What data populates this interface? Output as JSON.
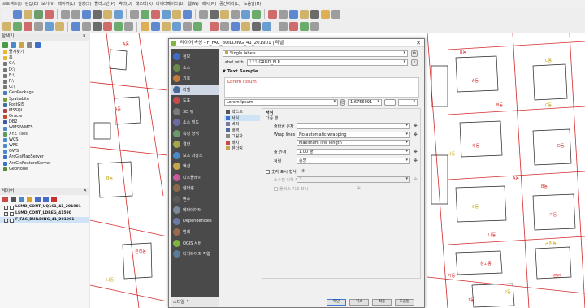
{
  "menubar": [
    "프로젝트(J)",
    "편집(E)",
    "보기(V)",
    "레이어(L)",
    "설정(S)",
    "플러그인(P)",
    "벡터(O)",
    "래스터(R)",
    "데이터베이스(D)",
    "웹(W)",
    "메시(M)",
    "공간처리(C)",
    "도움말(H)"
  ],
  "browser": {
    "title": "탐색기",
    "items": [
      {
        "label": "즐겨찾기",
        "icon": "star-icon",
        "color": "#e8b82c"
      },
      {
        "label": "홈",
        "icon": "folder-icon",
        "color": "#e8b82c"
      },
      {
        "label": "C:\\",
        "icon": "drive-icon",
        "color": "#777777"
      },
      {
        "label": "D:\\",
        "icon": "drive-icon",
        "color": "#777777"
      },
      {
        "label": "E:\\",
        "icon": "drive-icon",
        "color": "#777777"
      },
      {
        "label": "F:\\",
        "icon": "drive-icon",
        "color": "#777777"
      },
      {
        "label": "G:\\",
        "icon": "drive-icon",
        "color": "#777777"
      },
      {
        "label": "GeoPackage",
        "icon": "geopackage-icon",
        "color": "#4a7ab8"
      },
      {
        "label": "SpatiaLite",
        "icon": "spatialite-icon",
        "color": "#7a9a3a"
      },
      {
        "label": "PostGIS",
        "icon": "postgis-icon",
        "color": "#3a6ea5"
      },
      {
        "label": "MSSQL",
        "icon": "mssql-icon",
        "color": "#b04040"
      },
      {
        "label": "Oracle",
        "icon": "oracle-icon",
        "color": "#c04a2a"
      },
      {
        "label": "DB2",
        "icon": "db2-icon",
        "color": "#3a5aa5"
      },
      {
        "label": "WMS/WMTS",
        "icon": "wms-icon",
        "color": "#4a8ac8"
      },
      {
        "label": "XYZ Tiles",
        "icon": "xyz-icon",
        "color": "#5a9a5a"
      },
      {
        "label": "WCS",
        "icon": "wcs-icon",
        "color": "#4a8ac8"
      },
      {
        "label": "WFS",
        "icon": "wfs-icon",
        "color": "#4a8ac8"
      },
      {
        "label": "OWS",
        "icon": "ows-icon",
        "color": "#4a8ac8"
      },
      {
        "label": "ArcGisMapServer",
        "icon": "arcgis-icon",
        "color": "#3a6ec8"
      },
      {
        "label": "ArcGisFeatureServer",
        "icon": "arcgis-icon",
        "color": "#3a6ec8"
      },
      {
        "label": "GeoNode",
        "icon": "geonode-icon",
        "color": "#5a8a3a"
      }
    ]
  },
  "layers": {
    "title": "레이어",
    "items": [
      {
        "label": "LSMD_CONT_UQ161_41_201901",
        "checked": true,
        "selected": false
      },
      {
        "label": "LSMD_CONT_LDREG_41590",
        "checked": true,
        "selected": false
      },
      {
        "label": "F_FAC_BUILDING_41_201901",
        "checked": true,
        "selected": true
      }
    ]
  },
  "dialog": {
    "title": "레이어 속성 - F_FAC_BUILDING_41_201901 | 라벨",
    "close": "✕",
    "sidebar": [
      {
        "label": "정보",
        "color": "#3a6ec8",
        "icon": "info-icon"
      },
      {
        "label": "소스",
        "color": "#6a8a4a",
        "icon": "source-icon"
      },
      {
        "label": "기호",
        "color": "#c87a3a",
        "icon": "symbology-icon"
      },
      {
        "label": "라벨",
        "color": "#4a6a9a",
        "icon": "labels-icon"
      },
      {
        "label": "도표",
        "color": "#c84a4a",
        "icon": "diagrams-icon"
      },
      {
        "label": "3D 뷰",
        "color": "#7a7a7a",
        "icon": "3d-view-icon"
      },
      {
        "label": "소스 필드",
        "color": "#6a6aa5",
        "icon": "fields-icon"
      },
      {
        "label": "속성 양식",
        "color": "#6a9a6a",
        "icon": "attributes-form-icon"
      },
      {
        "label": "결합",
        "color": "#a5a54a",
        "icon": "joins-icon"
      },
      {
        "label": "보조 저장소",
        "color": "#4a8ac8",
        "icon": "auxiliary-storage-icon"
      },
      {
        "label": "액션",
        "color": "#c8a54a",
        "icon": "actions-icon"
      },
      {
        "label": "디스플레이",
        "color": "#c85a9a",
        "icon": "display-icon"
      },
      {
        "label": "렌더링",
        "color": "#8a6a4a",
        "icon": "rendering-icon"
      },
      {
        "label": "변수",
        "color": "#5a5a5a",
        "icon": "variables-icon"
      },
      {
        "label": "메타데이터",
        "color": "#7a8a9a",
        "icon": "metadata-icon"
      },
      {
        "label": "Dependencies",
        "color": "#6a7aa5",
        "icon": "dependencies-icon"
      },
      {
        "label": "범례",
        "color": "#9a6a4a",
        "icon": "legend-icon"
      },
      {
        "label": "QGIS 서버",
        "color": "#7fb53d",
        "icon": "qgis-server-icon"
      },
      {
        "label": "디지타이즈 작업",
        "color": "#5a7a9a",
        "icon": "digitizing-icon"
      }
    ],
    "mode": "Single labels",
    "label_with_label": "Label with",
    "label_with_value": "GRND_FLR",
    "text_sample_label": "Text Sample",
    "sample_text": "Lorem Ipsum",
    "sample_input": "Lorem Ipsum",
    "scale": "1:6756091",
    "subtabs": [
      "텍스트",
      "서식",
      "버퍼",
      "배경",
      "그림자",
      "배치",
      "렌더링"
    ],
    "subtab_active": 1,
    "format": {
      "section": "서식",
      "multiline_label": "다중 행",
      "wrap_char_label": "줄바꿈 문자",
      "wrap_char_value": "",
      "wrap_lines_label": "Wrap lines to",
      "wrap_lines_value": "No automatic wrapping",
      "max_line_value": "Maximum line length",
      "line_height_label": "줄 간격",
      "line_height_value": "1.00 줄",
      "alignment_label": "정렬",
      "alignment_value": "중앙",
      "number_format_label": "숫자 표시 형식",
      "decimal_label": "소수점 이하 자릿수",
      "decimal_value": "3",
      "plus_sign_label": "플러스 기호 표시"
    },
    "footer": {
      "style_button": "스타일",
      "ok_button": "확인",
      "cancel_button": "취소",
      "apply_button": "적용",
      "help_button": "도움말"
    }
  },
  "map_labels": [
    "A동",
    "B동",
    "C동",
    "A동",
    "B동",
    "C동",
    "D동",
    "가동",
    "나동",
    "A동",
    "B동",
    "C동",
    "가동",
    "나동",
    "공장동",
    "창고동",
    "A동",
    "B동",
    "본관",
    "1동",
    "2동",
    "관리동",
    "가동",
    "나동"
  ],
  "colors": {
    "parcel_line": "#d42a2a",
    "building_line": "#222222",
    "label_red": "#d42a2a",
    "label_yellow": "#c4a000",
    "sidebar_bg": "#4a4a4a",
    "accent": "#3d7ad4"
  }
}
